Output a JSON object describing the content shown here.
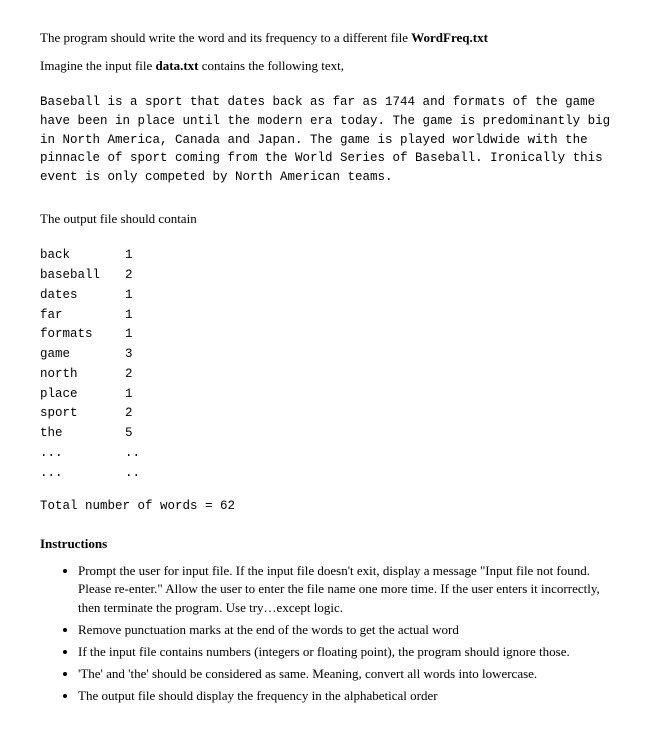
{
  "intro": {
    "line1_a": "The program should write the word and its frequency to a different file ",
    "line1_bold": "WordFreq.txt",
    "line2_a": "Imagine the input file ",
    "line2_bold": "data.txt",
    "line2_b": " contains the following text,"
  },
  "input_text": "Baseball is a sport that dates back as far as 1744 and formats of the game have been in place until the modern era today. The game is predominantly big in North America, Canada and Japan. The game is played worldwide with the pinnacle of sport coming from the World Series of Baseball. Ironically this event is only competed by North American teams.",
  "output_intro": "The output file should contain",
  "wordfreq": [
    {
      "word": "back",
      "count": "1"
    },
    {
      "word": "baseball",
      "count": "2"
    },
    {
      "word": "dates",
      "count": "1"
    },
    {
      "word": "far",
      "count": "1"
    },
    {
      "word": "formats",
      "count": "1"
    },
    {
      "word": "game",
      "count": "3"
    },
    {
      "word": "north",
      "count": "2"
    },
    {
      "word": "place",
      "count": "1"
    },
    {
      "word": "sport",
      "count": "2"
    },
    {
      "word": "the",
      "count": "5"
    },
    {
      "word": "...",
      "count": ".."
    },
    {
      "word": "...",
      "count": ".."
    }
  ],
  "total_line": "Total number of words = 62",
  "instructions_heading": "Instructions",
  "instructions": [
    "Prompt the user for input file. If the input file doesn't exit, display a message \"Input file not found. Please re-enter.\" Allow the user to enter the file name one more time. If the user enters it incorrectly, then terminate the program. Use try…except logic.",
    "Remove punctuation marks at the end of the words to get the actual word",
    "If the input file contains numbers (integers or floating point), the program should ignore those.",
    "'The' and 'the' should be considered as same. Meaning, convert all words into lowercase.",
    "The output file should display the frequency in the alphabetical order"
  ]
}
